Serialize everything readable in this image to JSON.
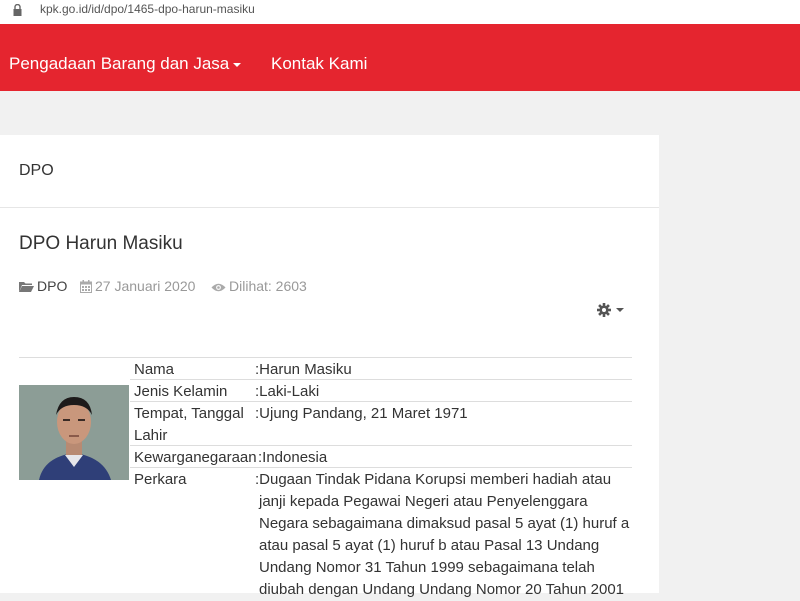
{
  "browser": {
    "url": "kpk.go.id/id/dpo/1465-dpo-harun-masiku"
  },
  "nav": {
    "item1": "Pengadaan Barang dan Jasa",
    "item2": "Kontak Kami"
  },
  "panel": {
    "heading": "DPO"
  },
  "article": {
    "title": "DPO Harun Masiku",
    "category": "DPO",
    "date": "27 Januari 2020",
    "views": "Dilihat: 2603"
  },
  "profile": {
    "rows": [
      {
        "label": "Nama",
        "value": ":Harun Masiku"
      },
      {
        "label": "Jenis Kelamin",
        "value": ":Laki-Laki"
      },
      {
        "label": "Tempat, Tanggal",
        "label2": "Lahir",
        "value": ":Ujung Pandang,  21 Maret 1971"
      },
      {
        "label": "Kewarganegaraan",
        "value": ":Indonesia"
      },
      {
        "label": "Perkara",
        "value": ":Dugaan Tindak Pidana Korupsi memberi hadiah atau",
        "value_lines": [
          "janji kepada Pegawai Negeri atau Penyelenggara",
          "Negara sebagaimana dimaksud pasal 5 ayat (1) huruf a",
          "atau pasal 5 ayat (1) huruf b atau  Pasal 13 Undang",
          "Undang Nomor 31 Tahun 1999 sebagaimana telah",
          "diubah dengan Undang Undang Nomor 20 Tahun 2001"
        ]
      }
    ]
  },
  "colors": {
    "brand_red": "#e5252f"
  },
  "icons": [
    "lock-icon",
    "folder-icon",
    "calendar-icon",
    "eye-icon",
    "gear-icon",
    "caret-down-icon"
  ]
}
